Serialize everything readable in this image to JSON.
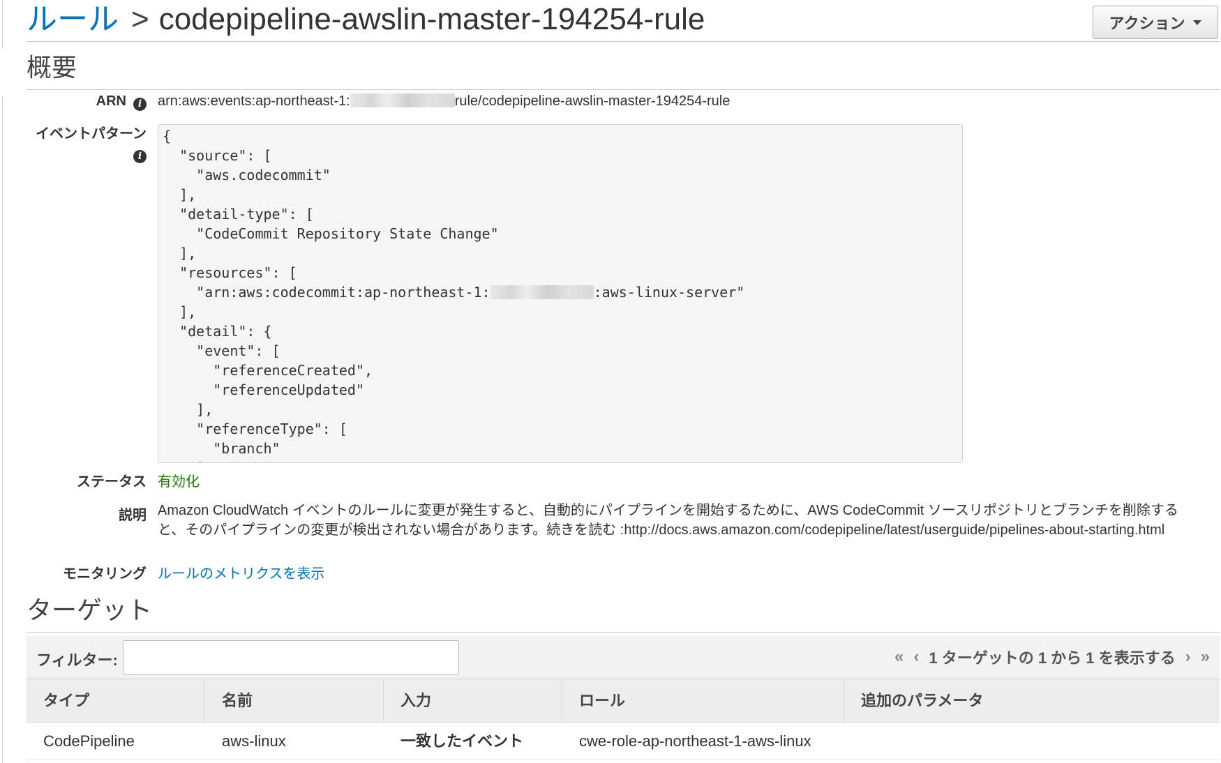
{
  "header": {
    "breadcrumb_link": "ルール",
    "breadcrumb_sep": ">",
    "rule_name": "codepipeline-awslin-master-194254-rule",
    "action_label": "アクション"
  },
  "summary": {
    "title": "概要",
    "arn_label": "ARN",
    "arn_prefix": "arn:aws:events:ap-northeast-1:",
    "arn_suffix": "rule/codepipeline-awslin-master-194254-rule",
    "pattern_label": "イベントパターン",
    "pattern_lines": [
      "{",
      "  \"source\": [",
      "    \"aws.codecommit\"",
      "  ],",
      "  \"detail-type\": [",
      "    \"CodeCommit Repository State Change\"",
      "  ],",
      "  \"resources\": [",
      "    \"arn:aws:codecommit:ap-northeast-1:",
      "  ],",
      "  \"detail\": {",
      "    \"event\": [",
      "      \"referenceCreated\",",
      "      \"referenceUpdated\"",
      "    ],",
      "    \"referenceType\": [",
      "      \"branch\"",
      "    ]"
    ],
    "resources_suffix": ":aws-linux-server\"",
    "status_label": "ステータス",
    "status_value": "有効化",
    "desc_label": "説明",
    "desc_value": "Amazon CloudWatch イベントのルールに変更が発生すると、自動的にパイプラインを開始するために、AWS CodeCommit ソースリポジトリとブランチを削除すると、そのパイプラインの変更が検出されない場合があります。続きを読む :http://docs.aws.amazon.com/codepipeline/latest/userguide/pipelines-about-starting.html",
    "monitoring_label": "モニタリング",
    "monitoring_link": "ルールのメトリクスを表示"
  },
  "targets": {
    "title": "ターゲット",
    "filter_label": "フィルター:",
    "filter_value": "",
    "pager_text": "1 ターゲットの 1 から 1 を表示する",
    "columns": [
      "タイプ",
      "名前",
      "入力",
      "ロール",
      "追加のパラメータ"
    ],
    "rows": [
      {
        "type": "CodePipeline",
        "name": "aws-linux",
        "input": "一致したイベント",
        "role": "cwe-role-ap-northeast-1-aws-linux",
        "extra": ""
      }
    ]
  },
  "colors": {
    "link": "#0073bb",
    "enabled": "#1d8102"
  }
}
